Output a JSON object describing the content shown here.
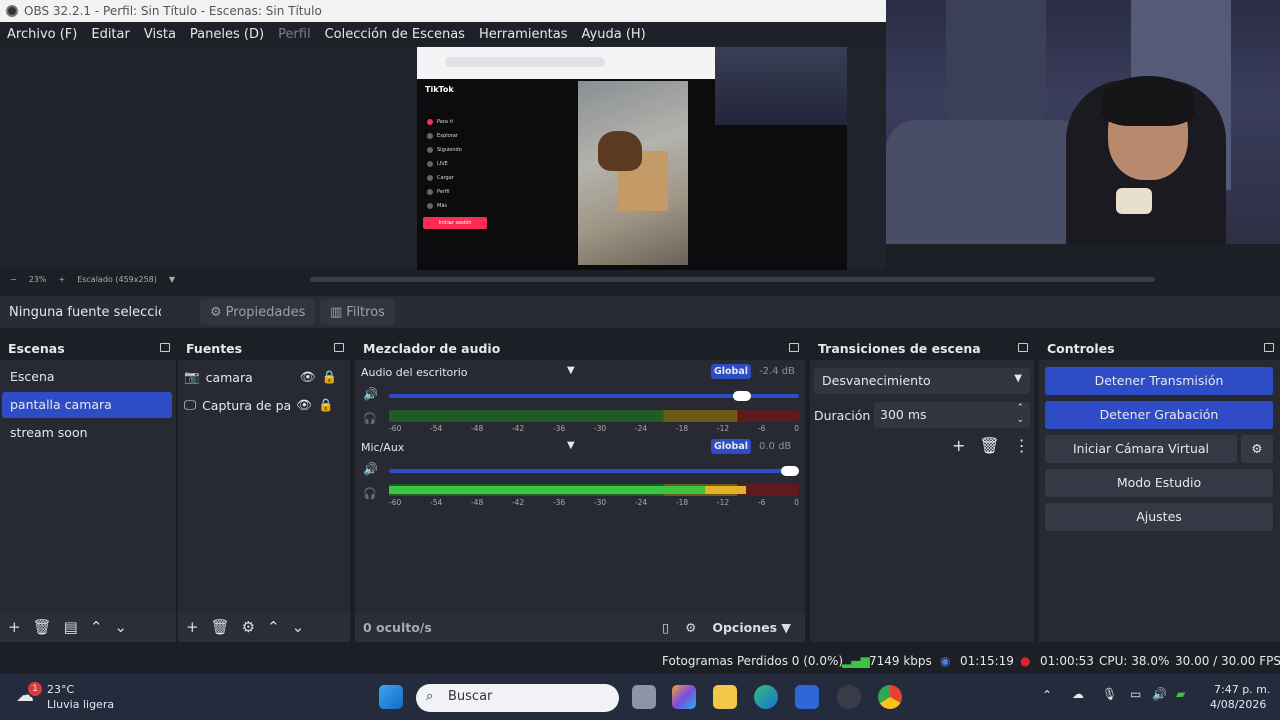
{
  "window": {
    "title": "OBS 32.2.1 - Perfil: Sin Título - Escenas: Sin Título"
  },
  "menu": [
    "Archivo (F)",
    "Editar",
    "Vista",
    "Paneles (D)",
    "Perfil",
    "Colección de Escenas",
    "Herramientas",
    "Ayuda (H)"
  ],
  "preview": {
    "tiktok_logo": "TikTok",
    "tiktok_items": [
      "Para ti",
      "Explorar",
      "Siguiendo",
      "LIVE",
      "Cargar",
      "Perfil",
      "Más"
    ],
    "tiktok_login": "Iniciar sesión",
    "zoom": "23%",
    "scale": "Escalado (459x258)"
  },
  "source_toolbar": {
    "no_source": "Ninguna fuente seleccionad",
    "properties": "Propiedades",
    "filters": "Filtros"
  },
  "scenes": {
    "title": "Escenas",
    "items": [
      "Escena",
      "pantalla camara",
      "stream soon"
    ],
    "selected": "pantalla camara"
  },
  "sources": {
    "title": "Fuentes",
    "items": [
      "camara",
      "Captura de pan"
    ]
  },
  "mixer": {
    "title": "Mezclador de audio",
    "channels": [
      {
        "name": "Audio del escritorio",
        "scope": "Global",
        "db": "-2.4 dB",
        "volume": 0.86,
        "level": 0.0
      },
      {
        "name": "Mic/Aux",
        "scope": "Global",
        "db": "0.0 dB",
        "volume": 1.0,
        "level": 0.87
      }
    ],
    "scale": [
      "-60",
      "-54",
      "-48",
      "-42",
      "-36",
      "-30",
      "-24",
      "-18",
      "-12",
      "-6",
      "0"
    ],
    "hidden": "0 oculto/s",
    "options": "Opciones"
  },
  "transitions": {
    "title": "Transiciones de escena",
    "selected": "Desvanecimiento",
    "duration_label": "Duración",
    "duration_value": "300 ms"
  },
  "controls": {
    "title": "Controles",
    "stop_stream": "Detener Transmisión",
    "stop_record": "Detener Grabación",
    "virtual_cam": "Iniciar Cámara Virtual",
    "studio": "Modo Estudio",
    "settings": "Ajustes"
  },
  "status": {
    "dropped": "Fotogramas Perdidos 0 (0.0%)",
    "bitrate": "7149 kbps",
    "stream_time": "01:15:19",
    "rec_time": "01:00:53",
    "cpu": "CPU: 38.0%",
    "fps": "30.00 / 30.00 FPS"
  },
  "taskbar": {
    "weather_temp": "23°C",
    "weather_desc": "Lluvia ligera",
    "badge": "1",
    "search": "Buscar",
    "time": "7:47 p. m.",
    "date": "4/08/2026"
  },
  "colors": {
    "accent": "#2d4cc6",
    "panel": "#272a33",
    "bg": "#1d1f26",
    "recording": "#e0202a"
  }
}
